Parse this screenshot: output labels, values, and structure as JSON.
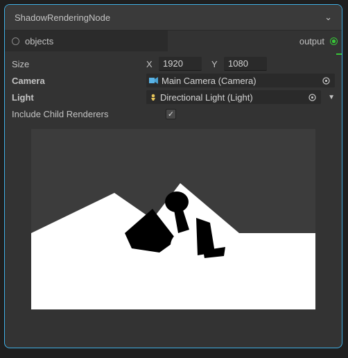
{
  "header": {
    "title": "ShadowRenderingNode"
  },
  "ports": {
    "in_label": "objects",
    "out_label": "output"
  },
  "size": {
    "label": "Size",
    "x_label": "X",
    "y_label": "Y",
    "x": "1920",
    "y": "1080"
  },
  "camera": {
    "label": "Camera",
    "value": "Main Camera (Camera)"
  },
  "light": {
    "label": "Light",
    "value": "Directional Light (Light)"
  },
  "include_children": {
    "label": "Include Child Renderers",
    "checked": true
  }
}
